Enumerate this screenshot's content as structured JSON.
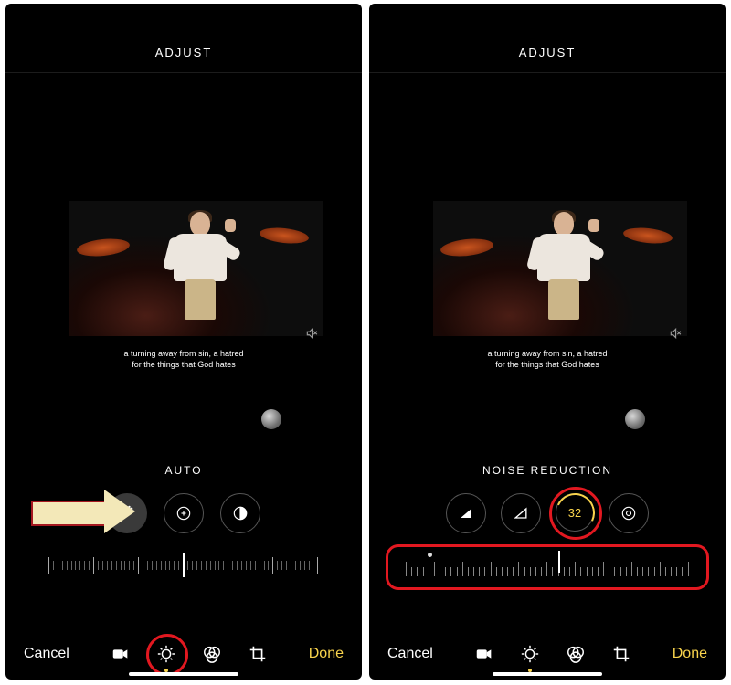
{
  "left": {
    "header": "ADJUST",
    "caption_l1": "a turning away from sin, a hatred",
    "caption_l2": "for the things that God hates",
    "filter_label": "AUTO",
    "cancel": "Cancel",
    "done": "Done"
  },
  "right": {
    "header": "ADJUST",
    "caption_l1": "a turning away from sin, a hatred",
    "caption_l2": "for the things that God hates",
    "filter_label": "NOISE REDUCTION",
    "value": "32",
    "cancel": "Cancel",
    "done": "Done"
  },
  "colors": {
    "accent": "#f8d34c",
    "highlight": "#e21820"
  }
}
